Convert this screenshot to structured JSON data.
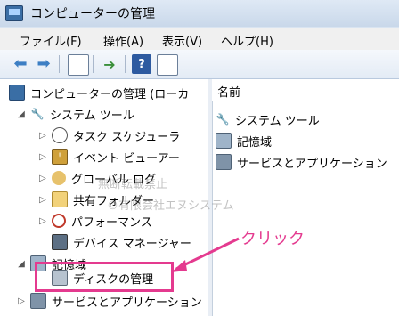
{
  "window": {
    "title": "コンピューターの管理"
  },
  "menu": {
    "items": [
      "ファイル(F)",
      "操作(A)",
      "表示(V)",
      "ヘルプ(H)"
    ]
  },
  "toolbar": {
    "icons": [
      "back-arrow-icon",
      "forward-arrow-icon",
      "show-hide-tree-icon",
      "export-list-icon",
      "help-icon",
      "show-action-pane-icon"
    ]
  },
  "tree": {
    "root": {
      "label": "コンピューターの管理 (ローカ"
    },
    "system_tools": {
      "label": "システム ツール"
    },
    "task_scheduler": {
      "label": "タスク スケジューラ"
    },
    "event_viewer": {
      "label": "イベント ビューアー"
    },
    "local_users": {
      "label": "グローバル ログ"
    },
    "shared_folders": {
      "label": "共有フォルダー"
    },
    "performance": {
      "label": "パフォーマンス"
    },
    "device_manager": {
      "label": "デバイス マネージャー"
    },
    "storage": {
      "label": "記憶域"
    },
    "disk_management": {
      "label": "ディスクの管理"
    },
    "services": {
      "label": "サービスとアプリケーション"
    }
  },
  "right_pane": {
    "header": "名前",
    "items": [
      {
        "label": "システム ツール"
      },
      {
        "label": "記憶域"
      },
      {
        "label": "サービスとアプリケーション"
      }
    ]
  },
  "annotation": {
    "click_text": "クリック",
    "watermark_line1": "無断転載禁止",
    "watermark_line2": "©有限会社エヌシステム"
  },
  "colors": {
    "highlight": "#e43a8f",
    "titlebar": "#c9d8ea"
  }
}
